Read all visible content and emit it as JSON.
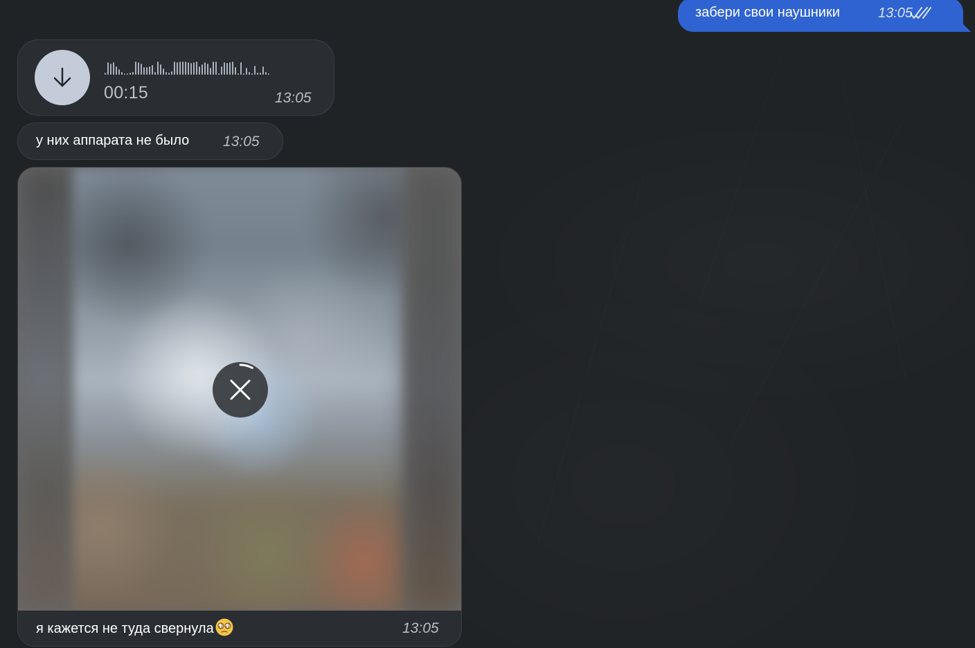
{
  "chat": {
    "outgoing_message": {
      "text": "забери свои наушники",
      "time": "13:05",
      "status_icon": "double-check-icon"
    },
    "voice_message": {
      "duration": "00:15",
      "time": "13:05",
      "download_icon": "download-arrow-icon",
      "waveform_levels": [
        3,
        18,
        16,
        18,
        12,
        8,
        4,
        2,
        2,
        3,
        4,
        19,
        18,
        16,
        11,
        11,
        12,
        14,
        4,
        19,
        15,
        9,
        4,
        3,
        5,
        19,
        18,
        19,
        19,
        19,
        18,
        17,
        18,
        19,
        12,
        15,
        18,
        16,
        10,
        19,
        19,
        2,
        12,
        18,
        17,
        18,
        19,
        11,
        2,
        18,
        2,
        10,
        4,
        2,
        13,
        3,
        3,
        12,
        4,
        2
      ]
    },
    "text_message": {
      "text": "у них аппарата не было",
      "time": "13:05"
    },
    "photo_message": {
      "caption": "я кажется не туда свернула",
      "emoji": "dizzy-face-emoji",
      "time": "13:05",
      "cancel_icon": "close-icon",
      "progress": 0.08
    }
  },
  "colors": {
    "background": "#202326",
    "outgoing_bubble": "#2f63d1",
    "incoming_bubble": "#2a2d31",
    "download_button": "#c3ccd8"
  }
}
